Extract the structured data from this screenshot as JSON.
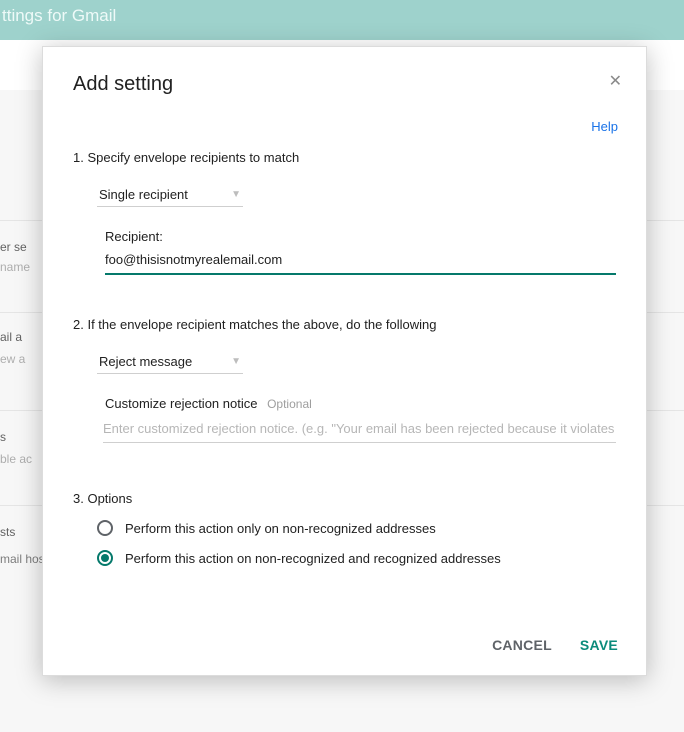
{
  "background": {
    "header_title": "ttings for Gmail",
    "section_user": "er se",
    "section_user_sub": "name",
    "section_ail": "ail a",
    "section_ail_sub": "ew a",
    "section_s": "s",
    "section_s_sub": "ble ac",
    "section_sts": "sts",
    "routing_text": "mail hosts for use in advanced routing, such as to direct messages to Microsoft Exchange."
  },
  "dialog": {
    "title": "Add setting",
    "help": "Help",
    "step1": {
      "label": "1. Specify envelope recipients to match",
      "select_value": "Single recipient",
      "recipient_label": "Recipient:",
      "recipient_value": "foo@thisisnotmyrealemail.com"
    },
    "step2": {
      "label": "2. If the envelope recipient matches the above, do the following",
      "select_value": "Reject message",
      "notice_label": "Customize rejection notice",
      "notice_optional": "Optional",
      "notice_placeholder": "Enter customized rejection notice. (e.g. \"Your email has been rejected because it violates organization policy\")."
    },
    "step3": {
      "label": "3. Options",
      "option1": "Perform this action only on non-recognized addresses",
      "option2": "Perform this action on non-recognized and recognized addresses",
      "selected": "option2"
    },
    "cancel": "CANCEL",
    "save": "SAVE"
  }
}
